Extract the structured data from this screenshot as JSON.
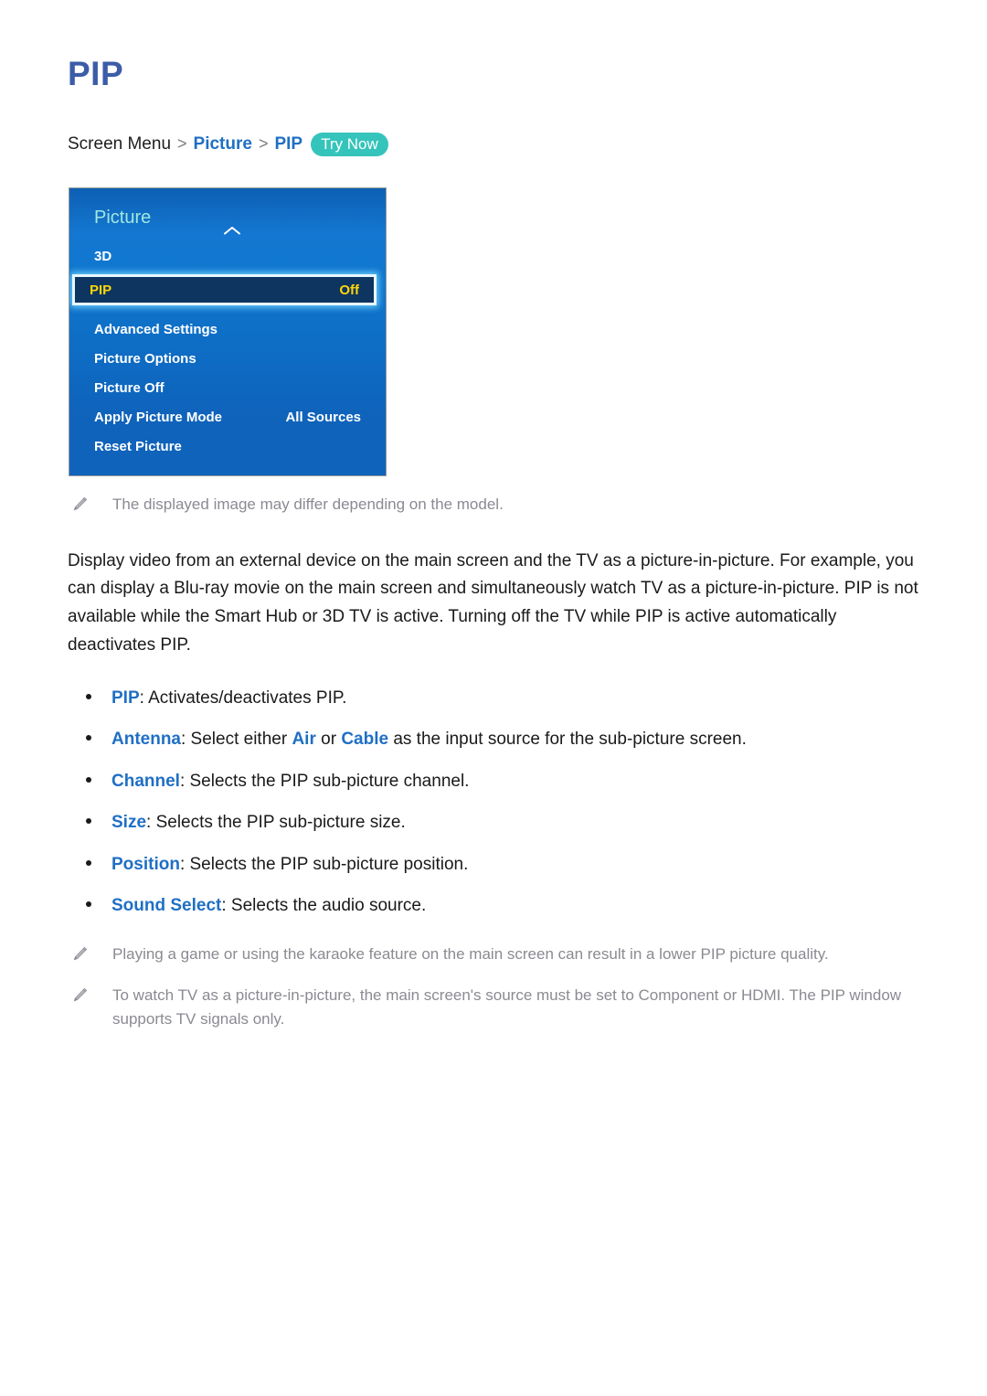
{
  "page": {
    "title": "PIP"
  },
  "breadcrumb": {
    "root": "Screen Menu",
    "separator": ">",
    "level1": "Picture",
    "level2": "PIP",
    "try_now": "Try Now",
    "try_now_color": "#35c4bb",
    "link_color": "#1f6fc4"
  },
  "tv_menu": {
    "header_title": "Picture",
    "header_title_color": "#9fe8df",
    "chevron_icon": "chevron-up-icon",
    "selected_index": 1,
    "selected_text_color": "#ffd60a",
    "selected_bg_color": "#0d355f",
    "selected_border_color": "#e9f7ff",
    "panel_bg_color": "#0f6cc6",
    "items": [
      {
        "label": "3D",
        "value": ""
      },
      {
        "label": "PIP",
        "value": "Off"
      },
      {
        "label": "Advanced Settings",
        "value": ""
      },
      {
        "label": "Picture Options",
        "value": ""
      },
      {
        "label": "Picture Off",
        "value": ""
      },
      {
        "label": "Apply Picture Mode",
        "value": "All Sources"
      },
      {
        "label": "Reset Picture",
        "value": ""
      }
    ]
  },
  "image_note": {
    "icon": "pencil-icon",
    "text": "The displayed image may differ depending on the model."
  },
  "description": {
    "paragraph": "Display video from an external device on the main screen and the TV as a picture-in-picture. For example, you can display a Blu-ray movie on the main screen and simultaneously watch TV as a picture-in-picture. PIP is not available while the Smart Hub or 3D TV is active. Turning off the TV while PIP is active automatically deactivates PIP."
  },
  "options": [
    {
      "term": "PIP",
      "pre": "",
      "text": ": Activates/deactivates PIP.",
      "inline_terms": []
    },
    {
      "term": "Antenna",
      "text_part1": ": Select either ",
      "inline1": "Air",
      "text_part2": " or ",
      "inline2": "Cable",
      "text_part3": " as the input source for the sub-picture screen."
    },
    {
      "term": "Channel",
      "text": ": Selects the PIP sub-picture channel."
    },
    {
      "term": "Size",
      "text": ": Selects the PIP sub-picture size."
    },
    {
      "term": "Position",
      "text": ": Selects the PIP sub-picture position."
    },
    {
      "term": "Sound Select",
      "text": ": Selects the audio source."
    }
  ],
  "footnotes": [
    {
      "icon": "pencil-icon",
      "text": "Playing a game or using the karaoke feature on the main screen can result in a lower PIP picture quality."
    },
    {
      "icon": "pencil-icon",
      "text": "To watch TV as a picture-in-picture, the main screen's source must be set to Component or HDMI. The PIP window supports TV signals only."
    }
  ]
}
